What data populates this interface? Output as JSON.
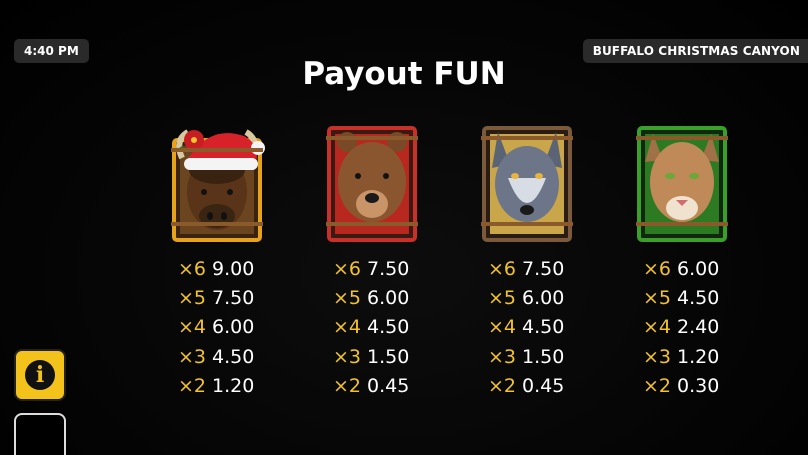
{
  "status_bar": {
    "time": "4:40 PM",
    "game_name": "BUFFALO CHRISTMAS CANYON"
  },
  "title": "Payout FUN",
  "symbols": [
    {
      "icon": "buffalo-santa-hat-icon",
      "frame_color": "#e6a21a",
      "payouts": [
        {
          "mult": "×6",
          "value": "9.00"
        },
        {
          "mult": "×5",
          "value": "7.50"
        },
        {
          "mult": "×4",
          "value": "6.00"
        },
        {
          "mult": "×3",
          "value": "4.50"
        },
        {
          "mult": "×2",
          "value": "1.20"
        }
      ]
    },
    {
      "icon": "bear-icon",
      "frame_color": "#c8302a",
      "payouts": [
        {
          "mult": "×6",
          "value": "7.50"
        },
        {
          "mult": "×5",
          "value": "6.00"
        },
        {
          "mult": "×4",
          "value": "4.50"
        },
        {
          "mult": "×3",
          "value": "1.50"
        },
        {
          "mult": "×2",
          "value": "0.45"
        }
      ]
    },
    {
      "icon": "wolf-icon",
      "frame_color": "#7a5a3a",
      "payouts": [
        {
          "mult": "×6",
          "value": "7.50"
        },
        {
          "mult": "×5",
          "value": "6.00"
        },
        {
          "mult": "×4",
          "value": "4.50"
        },
        {
          "mult": "×3",
          "value": "1.50"
        },
        {
          "mult": "×2",
          "value": "0.45"
        }
      ]
    },
    {
      "icon": "cougar-icon",
      "frame_color": "#3aa02a",
      "payouts": [
        {
          "mult": "×6",
          "value": "6.00"
        },
        {
          "mult": "×5",
          "value": "4.50"
        },
        {
          "mult": "×4",
          "value": "2.40"
        },
        {
          "mult": "×3",
          "value": "1.20"
        },
        {
          "mult": "×2",
          "value": "0.30"
        }
      ]
    }
  ],
  "info_button": {
    "icon": "info-icon",
    "glyph": "i"
  },
  "colors": {
    "multiplier": "#f3c32a",
    "value": "#ffffff",
    "accent": "#f3c31b"
  }
}
